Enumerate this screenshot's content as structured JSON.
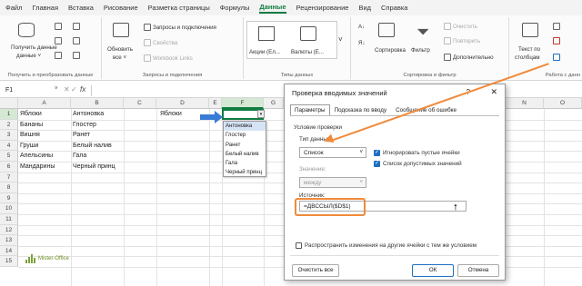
{
  "menu": [
    "Файл",
    "Главная",
    "Вставка",
    "Рисование",
    "Разметка страницы",
    "Формулы",
    "Данные",
    "Рецензирование",
    "Вид",
    "Справка"
  ],
  "menu_active": "Данные",
  "ribbon": {
    "get_data": "Получить данные",
    "get_data_sub": "данные ˅",
    "refresh": "Обновить",
    "refresh_sub": "все ˅",
    "queries": "Запросы и подключения",
    "properties": "Свойства",
    "workbook_links": "Workbook Links",
    "stocks": "Акции (Ел...",
    "currencies": "Валюты (Е...",
    "sort": "Сортировка",
    "filter": "Фильтр",
    "clear": "Очистить",
    "reapply": "Повторить",
    "advanced": "Дополнительно",
    "text_to_cols": "Текст по",
    "text_to_cols2": "столбцам",
    "grp_get": "Получить и преобразовать данные",
    "grp_queries": "Запросы и подключения",
    "grp_types": "Типы данных",
    "grp_sort": "Сортировка и фильтр",
    "grp_work": "Работа с данн"
  },
  "namebox": "F1",
  "fx": "fx",
  "columns": [
    "A",
    "B",
    "C",
    "D",
    "E",
    "F",
    "G",
    "",
    "",
    "",
    "",
    "",
    "N",
    "O"
  ],
  "rows": [
    "1",
    "2",
    "3",
    "4",
    "5",
    "6",
    "7",
    "8",
    "9",
    "10",
    "11",
    "12",
    "13",
    "14",
    "15"
  ],
  "colA": [
    "Яблоки",
    "Бананы",
    "Вишня",
    "Груши",
    "Апельсины",
    "Мандарины"
  ],
  "colB": [
    "Антоновка",
    "Глостер",
    "Ранет",
    "Белый налив",
    "Гала",
    "Черный принц"
  ],
  "d1": "Яблоки",
  "dropdown": [
    "Антоновка",
    "Глостер",
    "Ранет",
    "Белый налив",
    "Гала",
    "Черный принц"
  ],
  "dialog": {
    "title": "Проверка вводимых значений",
    "help": "?",
    "close": "✕",
    "tab1": "Параметры",
    "tab2": "Подсказка по вводу",
    "tab3": "Сообщение об ошибке",
    "conditions": "Условие проверки",
    "type_label": "Тип данных:",
    "type_value": "Список",
    "ignore_blank": "Игнорировать пустые ячейки",
    "in_cell": "Список допустимых значений",
    "value_label": "Значение:",
    "value_value": "между",
    "source_label": "Источник:",
    "source_value": "=ДВССЫЛ($D$1)",
    "apply_all": "Распространить изменения на другие ячейки с тем же условием",
    "clear_all": "Очистить все",
    "ok": "ОК",
    "cancel": "Отмена"
  },
  "logo_text": "Mister-Office",
  "colors": {
    "accent": "#1f6fc5",
    "highlight": "#f08a3a",
    "excel": "#107c41"
  }
}
